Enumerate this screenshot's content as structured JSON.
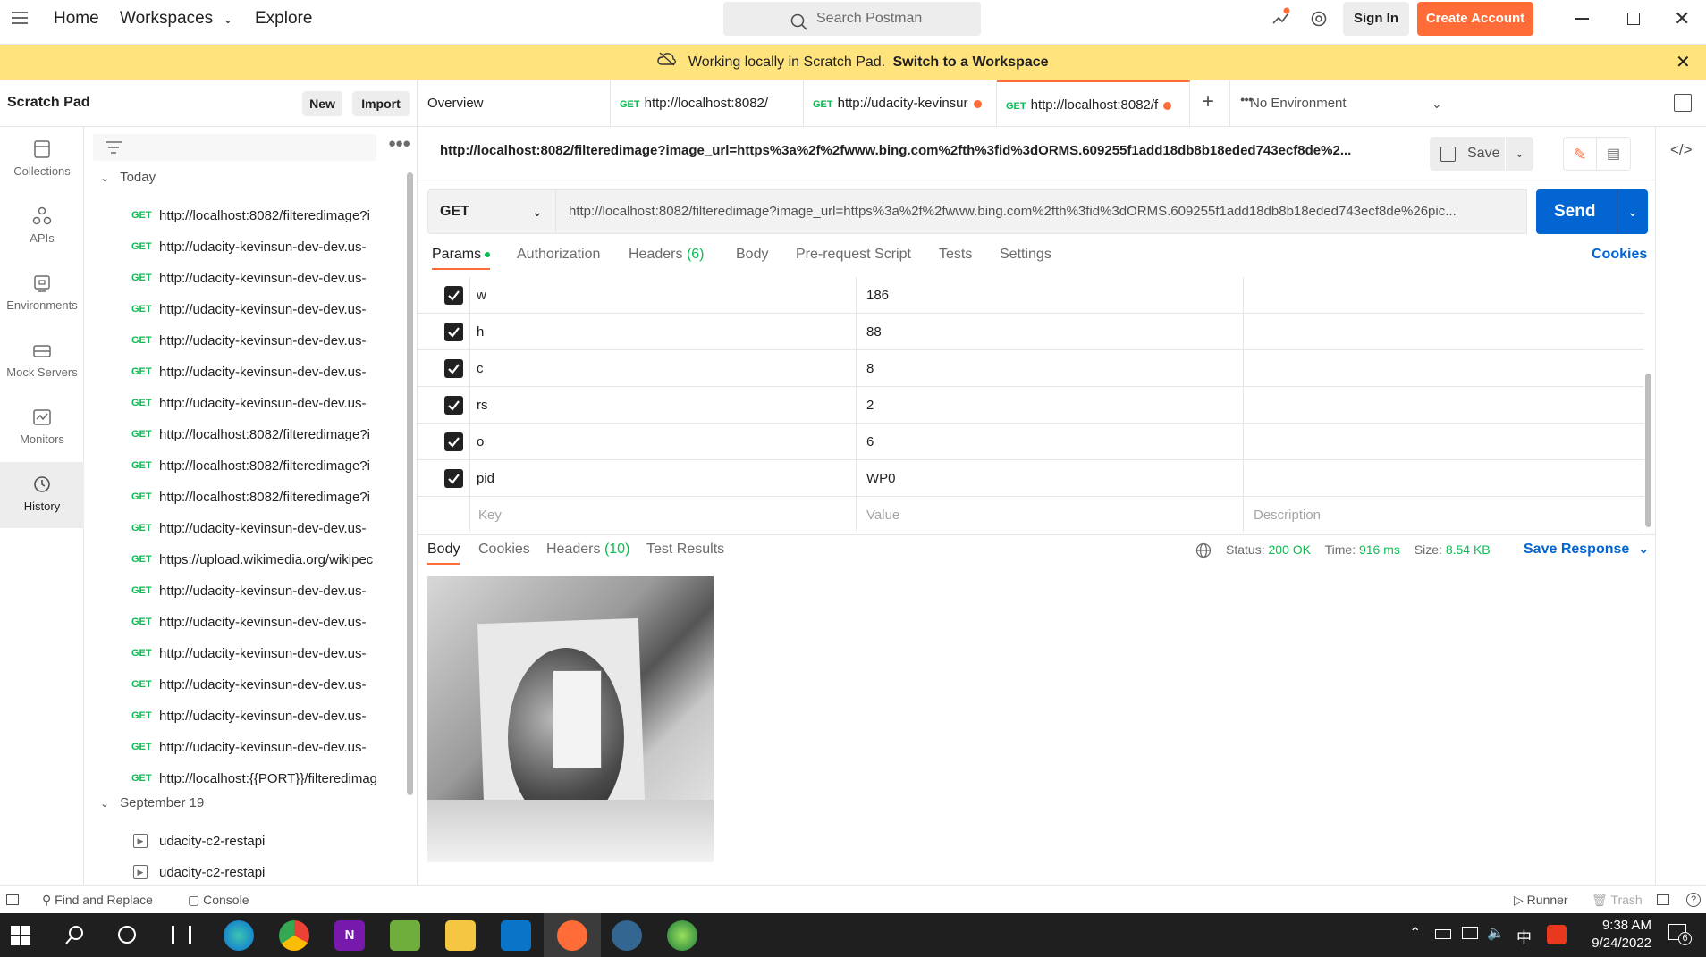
{
  "topbar": {
    "home": "Home",
    "workspaces": "Workspaces",
    "explore": "Explore",
    "search_placeholder": "Search Postman",
    "sign_in": "Sign In",
    "create_account": "Create Account"
  },
  "banner": {
    "text": "Working locally in Scratch Pad.",
    "link": "Switch to a Workspace"
  },
  "sidebar": {
    "title": "Scratch Pad",
    "new": "New",
    "import": "Import",
    "rail": [
      "Collections",
      "APIs",
      "Environments",
      "Mock Servers",
      "Monitors",
      "History"
    ],
    "group_today": "Today",
    "history_today": [
      {
        "method": "GET",
        "url": "http://localhost:8082/filteredimage?i"
      },
      {
        "method": "GET",
        "url": "http://udacity-kevinsun-dev-dev.us-"
      },
      {
        "method": "GET",
        "url": "http://udacity-kevinsun-dev-dev.us-"
      },
      {
        "method": "GET",
        "url": "http://udacity-kevinsun-dev-dev.us-"
      },
      {
        "method": "GET",
        "url": "http://udacity-kevinsun-dev-dev.us-"
      },
      {
        "method": "GET",
        "url": "http://udacity-kevinsun-dev-dev.us-"
      },
      {
        "method": "GET",
        "url": "http://udacity-kevinsun-dev-dev.us-"
      },
      {
        "method": "GET",
        "url": "http://localhost:8082/filteredimage?i"
      },
      {
        "method": "GET",
        "url": "http://localhost:8082/filteredimage?i"
      },
      {
        "method": "GET",
        "url": "http://localhost:8082/filteredimage?i"
      },
      {
        "method": "GET",
        "url": "http://udacity-kevinsun-dev-dev.us-"
      },
      {
        "method": "GET",
        "url": "https://upload.wikimedia.org/wikipec"
      },
      {
        "method": "GET",
        "url": "http://udacity-kevinsun-dev-dev.us-"
      },
      {
        "method": "GET",
        "url": "http://udacity-kevinsun-dev-dev.us-"
      },
      {
        "method": "GET",
        "url": "http://udacity-kevinsun-dev-dev.us-"
      },
      {
        "method": "GET",
        "url": "http://udacity-kevinsun-dev-dev.us-"
      },
      {
        "method": "GET",
        "url": "http://udacity-kevinsun-dev-dev.us-"
      },
      {
        "method": "GET",
        "url": "http://udacity-kevinsun-dev-dev.us-"
      },
      {
        "method": "GET",
        "url": "http://localhost:{{PORT}}/filteredimag"
      }
    ],
    "group_sep": "September 19",
    "history_sep": [
      "udacity-c2-restapi",
      "udacity-c2-restapi"
    ]
  },
  "tabs": {
    "overview": "Overview",
    "tab1": {
      "method": "GET",
      "url": "http://localhost:8082/"
    },
    "tab2": {
      "method": "GET",
      "url": "http://udacity-kevinsur"
    },
    "tab3": {
      "method": "GET",
      "url": "http://localhost:8082/f"
    },
    "environment": "No Environment"
  },
  "request": {
    "title": "http://localhost:8082/filteredimage?image_url=https%3a%2f%2fwww.bing.com%2fth%3fid%3dORMS.609255f1add18db8b18eded743ecf8de%2...",
    "save": "Save",
    "method": "GET",
    "url": "http://localhost:8082/filteredimage?image_url=https%3a%2f%2fwww.bing.com%2fth%3fid%3dORMS.609255f1add18db8b18eded743ecf8de%26pic...",
    "send": "Send"
  },
  "param_tabs": {
    "params": "Params",
    "authorization": "Authorization",
    "headers": "Headers",
    "headers_count": "(6)",
    "body": "Body",
    "prerequest": "Pre-request Script",
    "tests": "Tests",
    "settings": "Settings",
    "cookies": "Cookies"
  },
  "params": [
    {
      "key": "w",
      "value": "186"
    },
    {
      "key": "h",
      "value": "88"
    },
    {
      "key": "c",
      "value": "8"
    },
    {
      "key": "rs",
      "value": "2"
    },
    {
      "key": "o",
      "value": "6"
    },
    {
      "key": "pid",
      "value": "WP0"
    }
  ],
  "params_placeholder": {
    "key": "Key",
    "value": "Value",
    "description": "Description"
  },
  "response": {
    "body": "Body",
    "cookies": "Cookies",
    "headers": "Headers",
    "headers_count": "(10)",
    "test_results": "Test Results",
    "status_label": "Status:",
    "status": "200 OK",
    "time_label": "Time:",
    "time": "916 ms",
    "size_label": "Size:",
    "size": "8.54 KB",
    "save_response": "Save Response"
  },
  "footer": {
    "find_replace": "Find and Replace",
    "console": "Console",
    "runner": "Runner",
    "trash": "Trash"
  },
  "taskbar": {
    "time": "9:38 AM",
    "date": "9/24/2022",
    "ime": "中",
    "notif": "6"
  }
}
